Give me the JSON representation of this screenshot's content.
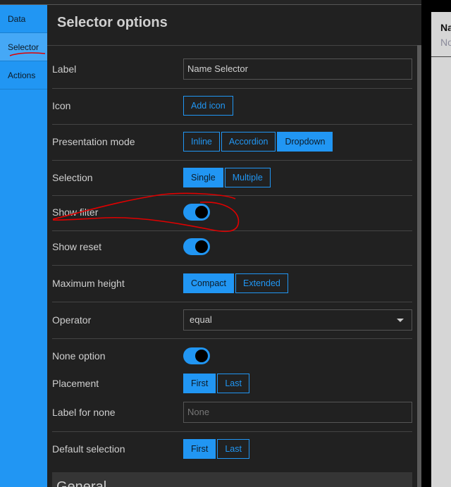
{
  "sidebar": {
    "items": [
      {
        "label": "Data"
      },
      {
        "label": "Selector",
        "active": true
      },
      {
        "label": "Actions"
      }
    ]
  },
  "panel": {
    "title": "Selector options",
    "label": {
      "label": "Label",
      "value": "Name Selector"
    },
    "icon": {
      "label": "Icon",
      "button": "Add icon"
    },
    "presentation": {
      "label": "Presentation mode",
      "options": [
        "Inline",
        "Accordion",
        "Dropdown"
      ],
      "selected": "Dropdown"
    },
    "selection": {
      "label": "Selection",
      "options": [
        "Single",
        "Multiple"
      ],
      "selected": "Single"
    },
    "show_filter": {
      "label": "Show filter",
      "on": true
    },
    "show_reset": {
      "label": "Show reset",
      "on": true
    },
    "max_height": {
      "label": "Maximum height",
      "options": [
        "Compact",
        "Extended"
      ],
      "selected": "Compact"
    },
    "operator": {
      "label": "Operator",
      "value": "equal"
    },
    "none_option": {
      "label": "None option",
      "on": true
    },
    "placement": {
      "label": "Placement",
      "options": [
        "First",
        "Last"
      ],
      "selected": "First"
    },
    "label_for_none": {
      "label": "Label for none",
      "placeholder": "None"
    },
    "default_selection": {
      "label": "Default selection",
      "options": [
        "First",
        "Last"
      ],
      "selected": "First"
    },
    "general": {
      "title": "General"
    }
  },
  "preview": {
    "title": "Na",
    "subtitle": "No"
  },
  "colors": {
    "accent": "#2196f3",
    "panel_bg": "#212121",
    "annotation": "#e00000"
  }
}
